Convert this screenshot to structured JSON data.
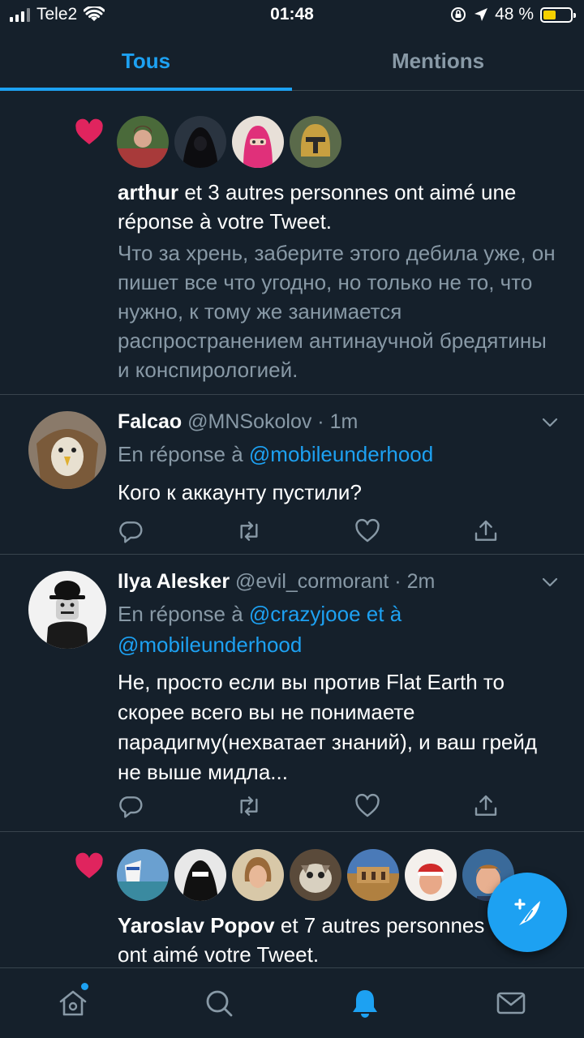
{
  "status_bar": {
    "carrier": "Tele2",
    "time": "01:48",
    "battery": "48 %",
    "battery_level": 0.48
  },
  "tabs": [
    {
      "label": "Tous",
      "active": true
    },
    {
      "label": "Mentions",
      "active": false
    }
  ],
  "feed": {
    "like1": {
      "name": "arthur",
      "text": " et 3 autres personnes ont aimé une réponse à votre Tweet.",
      "quote": "Что за хрень, заберите этого дебила уже, он пишет все что угодно, но только не то, что нужно, к тому же занимается распространением антинаучной бредятины и конспирологией."
    },
    "tweet1": {
      "name": "Falcao",
      "handle": "@MNSokolov",
      "sep": " · ",
      "time": "1m",
      "reply_prefix": "En réponse à ",
      "reply_to": "@mobileunderhood",
      "text": "Кого к аккаунту пустили?"
    },
    "tweet2": {
      "name": "Ilya Alesker",
      "handle": "@evil_cormorant",
      "sep": " · ",
      "time": "2m",
      "reply_prefix": "En réponse à ",
      "reply_to": "@crazyjooe et à @mobileunderhood",
      "text": "Не, просто если вы против Flat Earth то скорее всего вы не понимаете парадигму(нехватает знаний), и ваш грейд не выше мидла..."
    },
    "like2": {
      "name": "Yaroslav Popov",
      "text": " et 7 autres personnes ont aimé votre Tweet."
    }
  },
  "colors": {
    "background": "#15202b",
    "accent": "#1da1f2",
    "like": "#e0245e",
    "secondary_text": "#8899a6",
    "divider": "#38444d"
  },
  "icons": {
    "status": [
      "signal-icon",
      "wifi-icon",
      "orientation-lock-icon",
      "location-arrow-icon",
      "battery-icon"
    ],
    "actions": [
      "reply-icon",
      "retweet-icon",
      "like-icon",
      "share-icon"
    ],
    "nav": [
      "home-icon",
      "search-icon",
      "notifications-icon",
      "messages-icon"
    ],
    "fab": "compose-tweet-icon"
  }
}
